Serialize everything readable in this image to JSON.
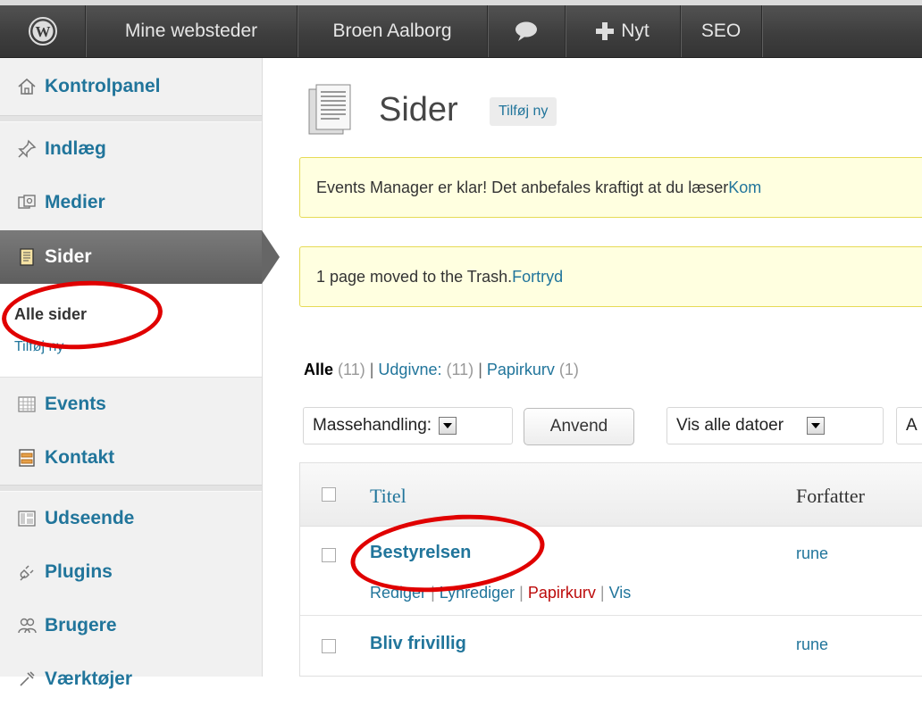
{
  "admin_bar": {
    "my_sites": "Mine websteder",
    "site_name": "Broen Aalborg",
    "new_label": "Nyt",
    "seo_label": "SEO"
  },
  "menu": {
    "dashboard": "Kontrolpanel",
    "posts": "Indlæg",
    "media": "Medier",
    "pages": "Sider",
    "pages_sub": {
      "all": "Alle sider",
      "add": "Tilføj ny"
    },
    "events": "Events",
    "contact": "Kontakt",
    "appearance": "Udseende",
    "plugins": "Plugins",
    "users": "Brugere",
    "tools": "Værktøjer"
  },
  "page": {
    "title": "Sider",
    "add_new": "Tilføj ny"
  },
  "notices": {
    "events": {
      "text": "Events Manager er klar! Det anbefales kraftigt at du læser ",
      "link": "Kom"
    },
    "trash": {
      "text": "1 page moved to the Trash. ",
      "link": "Fortryd"
    }
  },
  "filters": {
    "all": "Alle",
    "all_count": "(11)",
    "published": "Udgivne:",
    "published_count": "(11)",
    "trash": "Papirkurv",
    "trash_count": "(1)"
  },
  "toolbar": {
    "bulk_action": "Massehandling:",
    "apply": "Anvend",
    "dates": "Vis alle datoer",
    "cat_partial": "A"
  },
  "table": {
    "columns": {
      "title": "Titel",
      "author": "Forfatter"
    },
    "rows": [
      {
        "title": "Bestyrelsen",
        "author": "rune",
        "actions": {
          "edit": "Rediger",
          "quick": "Lynrediger",
          "trash": "Papirkurv",
          "view": "Vis"
        }
      },
      {
        "title": "Bliv frivillig",
        "author": "rune"
      }
    ]
  },
  "colors": {
    "link": "#21759b",
    "trash": "#bc0b0b",
    "notice_bg": "#ffffe0",
    "annotation": "#e00000"
  }
}
